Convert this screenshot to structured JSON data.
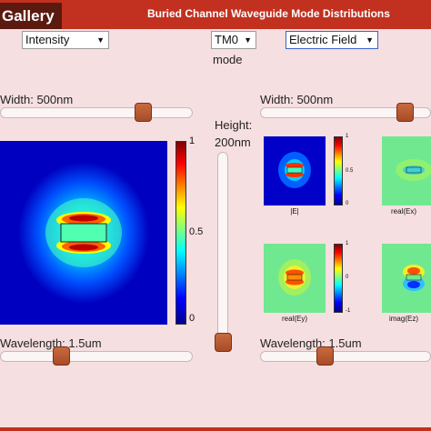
{
  "header": {
    "tab_label": "Gallery",
    "title": "Buried Channel Waveguide Mode Distributions"
  },
  "controls": {
    "quantity_select": "Intensity",
    "mode_select": "TM0",
    "mode_label": "mode",
    "field_select": "Electric Field",
    "left_width_label": "Width: 500nm",
    "right_width_label": "Width: 500nm",
    "height_label_line1": "Height:",
    "height_label_line2": "200nm",
    "left_wavelength_label": "Wavelength: 1.5um",
    "right_wavelength_label": "Wavelength: 1.5um"
  },
  "colorbars": {
    "main": [
      "1",
      "0.5",
      "0"
    ],
    "small_abs": [
      "1",
      "0.5",
      "0"
    ],
    "small_signed": [
      "1",
      "0",
      "-1"
    ]
  },
  "plots": {
    "abs_e": "|E|",
    "real_ex": "real(Ex)",
    "real_ey": "real(Ey)",
    "imag_ez": "imag(Ez)"
  },
  "colors": {
    "header": "#c2301f",
    "tab": "#5a1a10",
    "background": "#f6dfe1",
    "slider_thumb": "#b85a32"
  }
}
